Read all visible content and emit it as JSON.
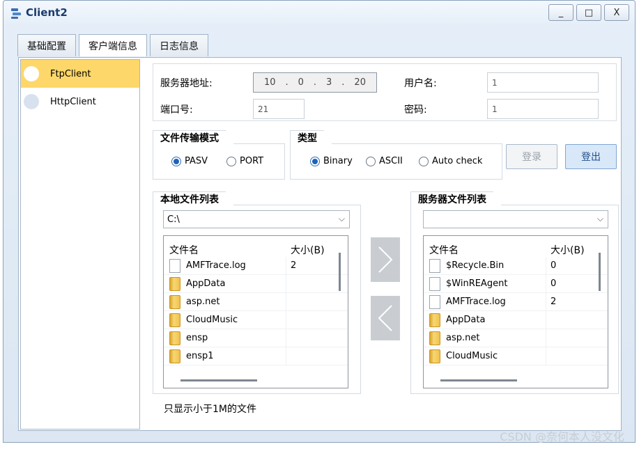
{
  "window": {
    "title": "Client2",
    "minimize": "_",
    "maximize": "□",
    "close": "X"
  },
  "tabs": [
    {
      "label": "基础配置"
    },
    {
      "label": "客户端信息"
    },
    {
      "label": "日志信息"
    }
  ],
  "sidebar": {
    "items": [
      {
        "label": "FtpClient"
      },
      {
        "label": "HttpClient"
      }
    ]
  },
  "server": {
    "address_label": "服务器地址:",
    "ip": [
      "10",
      "0",
      "3",
      "20"
    ],
    "username_label": "用户名:",
    "username": "1",
    "port_label": "端口号:",
    "port": "21",
    "password_label": "密码:",
    "password": "1"
  },
  "transfer_mode": {
    "title": "文件传输模式",
    "options": [
      "PASV",
      "PORT"
    ],
    "selected": "PASV"
  },
  "type": {
    "title": "类型",
    "options": [
      "Binary",
      "ASCII",
      "Auto check"
    ],
    "selected": "Binary"
  },
  "buttons": {
    "login": "登录",
    "logout": "登出"
  },
  "local": {
    "title": "本地文件列表",
    "path": "C:\\",
    "col_name": "文件名",
    "col_size": "大小(B)",
    "rows": [
      {
        "name": "AMFTrace.log",
        "size": "2",
        "icon": "file"
      },
      {
        "name": "AppData",
        "size": "",
        "icon": "folder"
      },
      {
        "name": "asp.net",
        "size": "",
        "icon": "folder"
      },
      {
        "name": "CloudMusic",
        "size": "",
        "icon": "folder"
      },
      {
        "name": "ensp",
        "size": "",
        "icon": "folder"
      },
      {
        "name": "ensp1",
        "size": "",
        "icon": "folder"
      }
    ]
  },
  "remote": {
    "title": "服务器文件列表",
    "path": "",
    "col_name": "文件名",
    "col_size": "大小(B)",
    "rows": [
      {
        "name": "$Recycle.Bin",
        "size": "0",
        "icon": "file"
      },
      {
        "name": "$WinREAgent",
        "size": "0",
        "icon": "file"
      },
      {
        "name": "AMFTrace.log",
        "size": "2",
        "icon": "file"
      },
      {
        "name": "AppData",
        "size": "",
        "icon": "folder"
      },
      {
        "name": "asp.net",
        "size": "",
        "icon": "folder"
      },
      {
        "name": "CloudMusic",
        "size": "",
        "icon": "folder"
      }
    ]
  },
  "footer_note": "只显示小于1M的文件",
  "watermark": "CSDN @奈何本人没文化",
  "colors": {
    "selected_sidebar": "#fdd76a",
    "radio_selected": "#1d63b9",
    "logout_button": "#d8e8f8"
  }
}
